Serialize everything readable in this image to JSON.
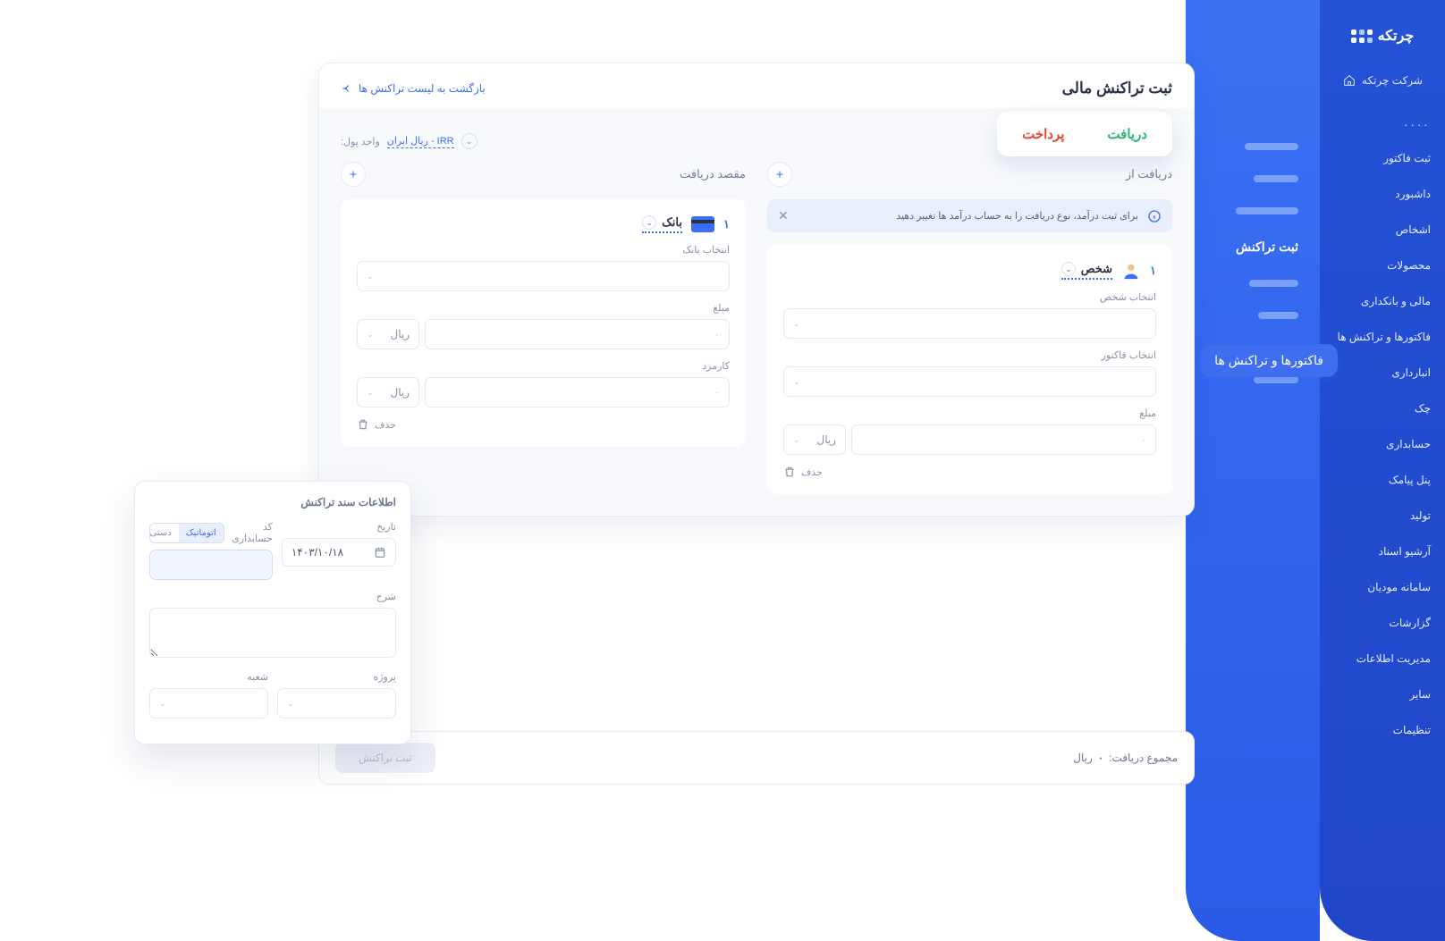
{
  "brand": "چرتکه",
  "company": "شرکت چرتکه",
  "sidebar": {
    "items": [
      {
        "label": "...."
      },
      {
        "label": "ثبت فاکتور"
      },
      {
        "label": "داشبورد"
      },
      {
        "label": "اشخاص"
      },
      {
        "label": "محصولات"
      },
      {
        "label": "مالی و بانکداری"
      },
      {
        "label": "فاکتورها و تراکنش ها"
      },
      {
        "label": "انبارداری"
      },
      {
        "label": "چک"
      },
      {
        "label": "حسابداری"
      },
      {
        "label": "پنل پیامک"
      },
      {
        "label": "تولید"
      },
      {
        "label": "آرشیو اسناد"
      },
      {
        "label": "سامانه مودیان"
      },
      {
        "label": "گزارشات"
      },
      {
        "label": "مدیریت اطلاعات"
      },
      {
        "label": "سایر"
      },
      {
        "label": "تنظیمات"
      }
    ]
  },
  "pill_tag": "فاکتورها و تراکنش ها",
  "subpanel": {
    "active": "ثبت تراکنش"
  },
  "page": {
    "title": "ثبت تراکنش مالی",
    "back": "بازگشت به لیست تراکنش ها"
  },
  "tabs": {
    "receive": "دریافت",
    "pay": "پرداخت"
  },
  "currency": {
    "label": "واحد پول:",
    "value": "IRR - ریال ایران"
  },
  "source_col": {
    "title": "دریافت از",
    "banner": "برای ثبت درآمد، نوع دریافت را به حساب درآمد ها تغییر دهید",
    "num": "۱",
    "type": "شخص",
    "fields": {
      "person_label": "انتخاب شخص",
      "invoice_label": "انتخاب فاکتور",
      "amount_label": "مبلغ",
      "zero": "۰",
      "unit": "ریال"
    },
    "delete": "حذف"
  },
  "dest_col": {
    "title": "مقصد دریافت",
    "num": "۱",
    "type": "بانک",
    "fields": {
      "bank_label": "انتخاب بانک",
      "amount_label": "مبلغ",
      "fee_label": "کارمزد",
      "zero": "۰",
      "unit": "ریال"
    },
    "delete": "حذف"
  },
  "doc": {
    "title": "اطلاعات سند تراکنش",
    "date_label": "تاریخ",
    "date_value": "۱۴۰۳/۱۰/۱۸",
    "code_label": "کد حسابداری",
    "toggle_auto": "اتوماتیک",
    "toggle_manual": "دستی",
    "desc_label": "شرح",
    "project_label": "پروژه",
    "branch_label": "شعبه"
  },
  "footer": {
    "total_label": "مجموع دریافت:",
    "total_value": "۰",
    "unit": "ریال",
    "submit": "ثبت تراکنش"
  }
}
